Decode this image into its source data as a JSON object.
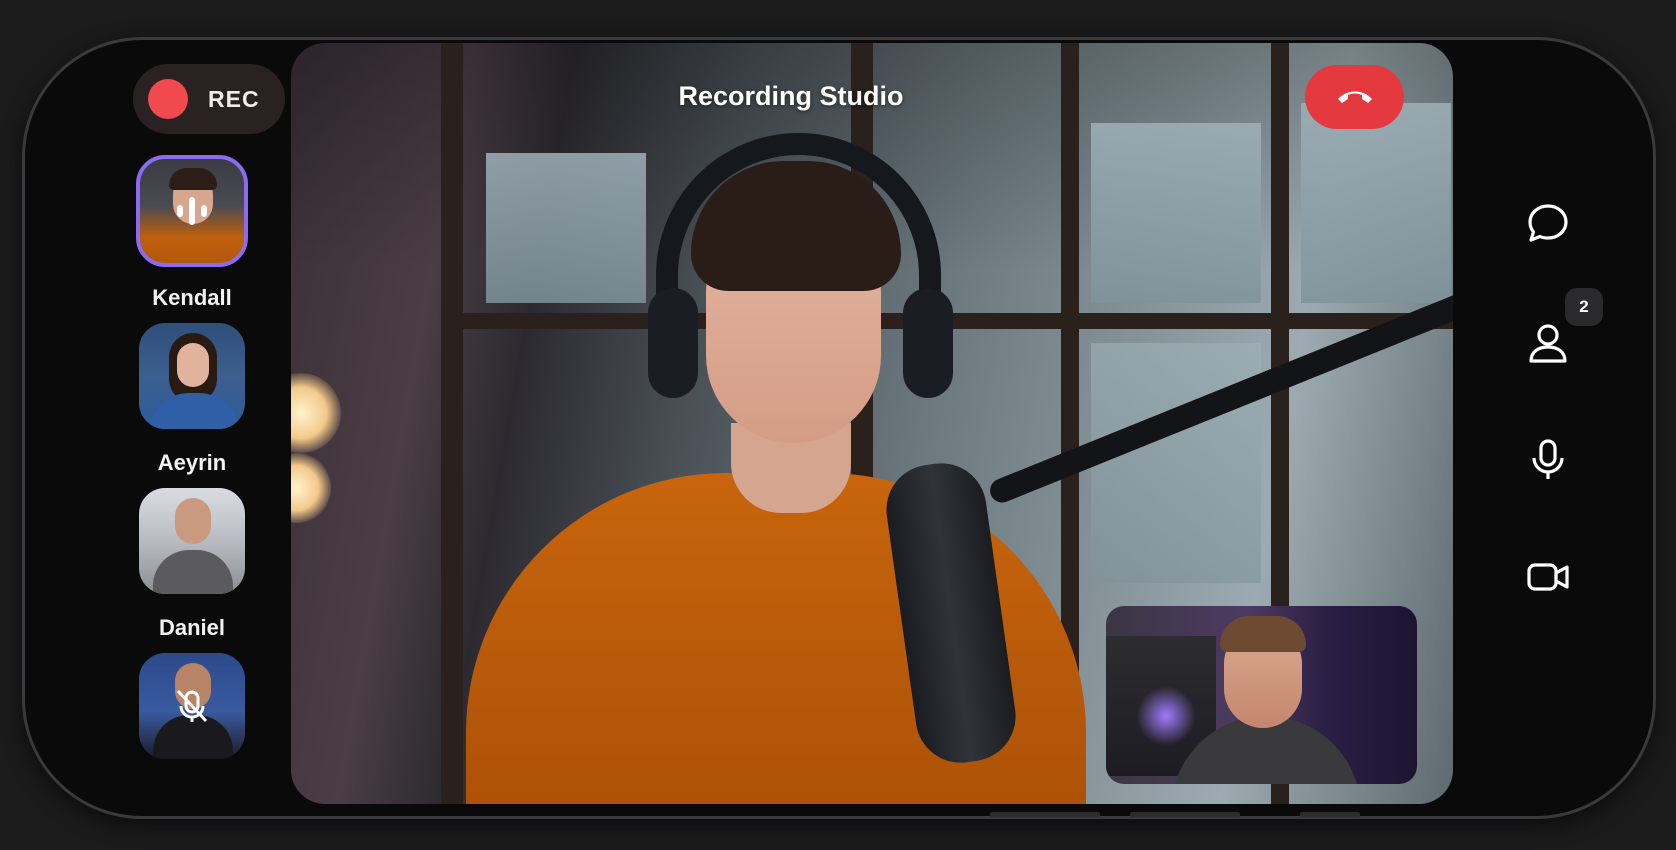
{
  "app": {
    "title": "Recording Studio"
  },
  "recording": {
    "label": "REC"
  },
  "participants": [
    {
      "name": "Kendall",
      "state": "speaking"
    },
    {
      "name": "Aeyrin",
      "state": "idle"
    },
    {
      "name": "Daniel",
      "state": "idle"
    },
    {
      "name": "",
      "state": "muted"
    }
  ],
  "controls": {
    "end_call_icon": "phone-hangup-icon",
    "chat_icon": "chat-bubble-icon",
    "participants_icon": "user-icon",
    "participants_count": "2",
    "mic_icon": "microphone-icon",
    "camera_icon": "video-camera-icon"
  },
  "colors": {
    "accent": "#8b6bf2",
    "rec": "#f04a4f",
    "end_call": "#e4393f"
  }
}
